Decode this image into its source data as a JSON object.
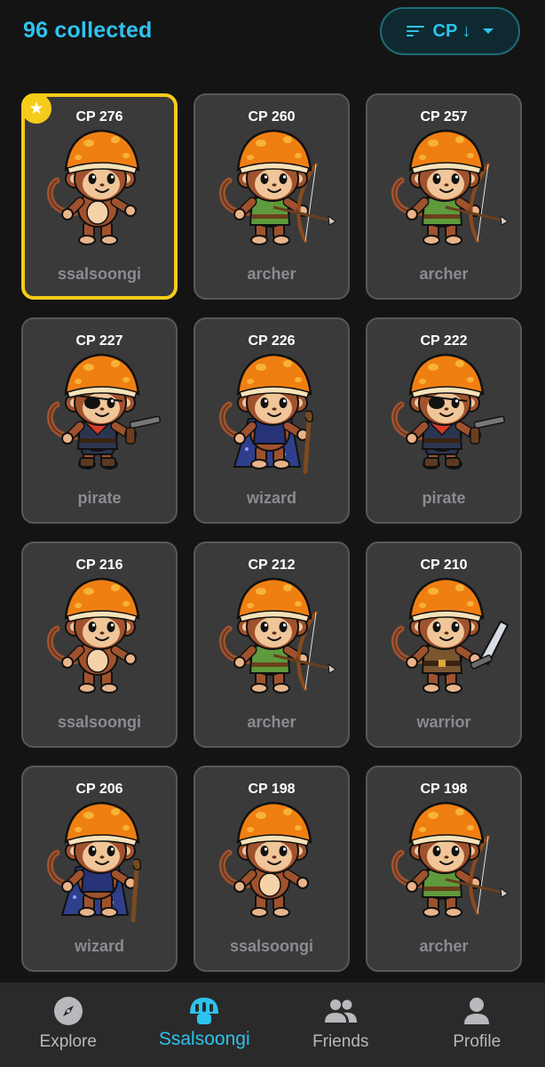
{
  "header": {
    "collected_label": "96 collected",
    "sort_label": "CP ↓"
  },
  "cards": [
    {
      "cp": "CP 276",
      "name": "ssalsoongi",
      "type": "ssalsoongi",
      "favorite": true
    },
    {
      "cp": "CP 260",
      "name": "archer",
      "type": "archer",
      "favorite": false
    },
    {
      "cp": "CP 257",
      "name": "archer",
      "type": "archer",
      "favorite": false
    },
    {
      "cp": "CP 227",
      "name": "pirate",
      "type": "pirate",
      "favorite": false
    },
    {
      "cp": "CP 226",
      "name": "wizard",
      "type": "wizard",
      "favorite": false
    },
    {
      "cp": "CP 222",
      "name": "pirate",
      "type": "pirate",
      "favorite": false
    },
    {
      "cp": "CP 216",
      "name": "ssalsoongi",
      "type": "ssalsoongi",
      "favorite": false
    },
    {
      "cp": "CP 212",
      "name": "archer",
      "type": "archer",
      "favorite": false
    },
    {
      "cp": "CP 210",
      "name": "warrior",
      "type": "warrior",
      "favorite": false
    },
    {
      "cp": "CP 206",
      "name": "wizard",
      "type": "wizard",
      "favorite": false
    },
    {
      "cp": "CP 198",
      "name": "ssalsoongi",
      "type": "ssalsoongi",
      "favorite": false
    },
    {
      "cp": "CP 198",
      "name": "archer",
      "type": "archer",
      "favorite": false
    }
  ],
  "nav": [
    {
      "label": "Explore",
      "icon": "compass-icon",
      "active": false
    },
    {
      "label": "Ssalsoongi",
      "icon": "mushroom-icon",
      "active": true
    },
    {
      "label": "Friends",
      "icon": "people-icon",
      "active": false
    },
    {
      "label": "Profile",
      "icon": "person-icon",
      "active": false
    }
  ],
  "colors": {
    "accent": "#2ec3ee",
    "favorite": "#f5cc1a",
    "card_bg": "#3a3a3a",
    "page_bg": "#141414",
    "nav_bg": "#2a2a2a"
  }
}
